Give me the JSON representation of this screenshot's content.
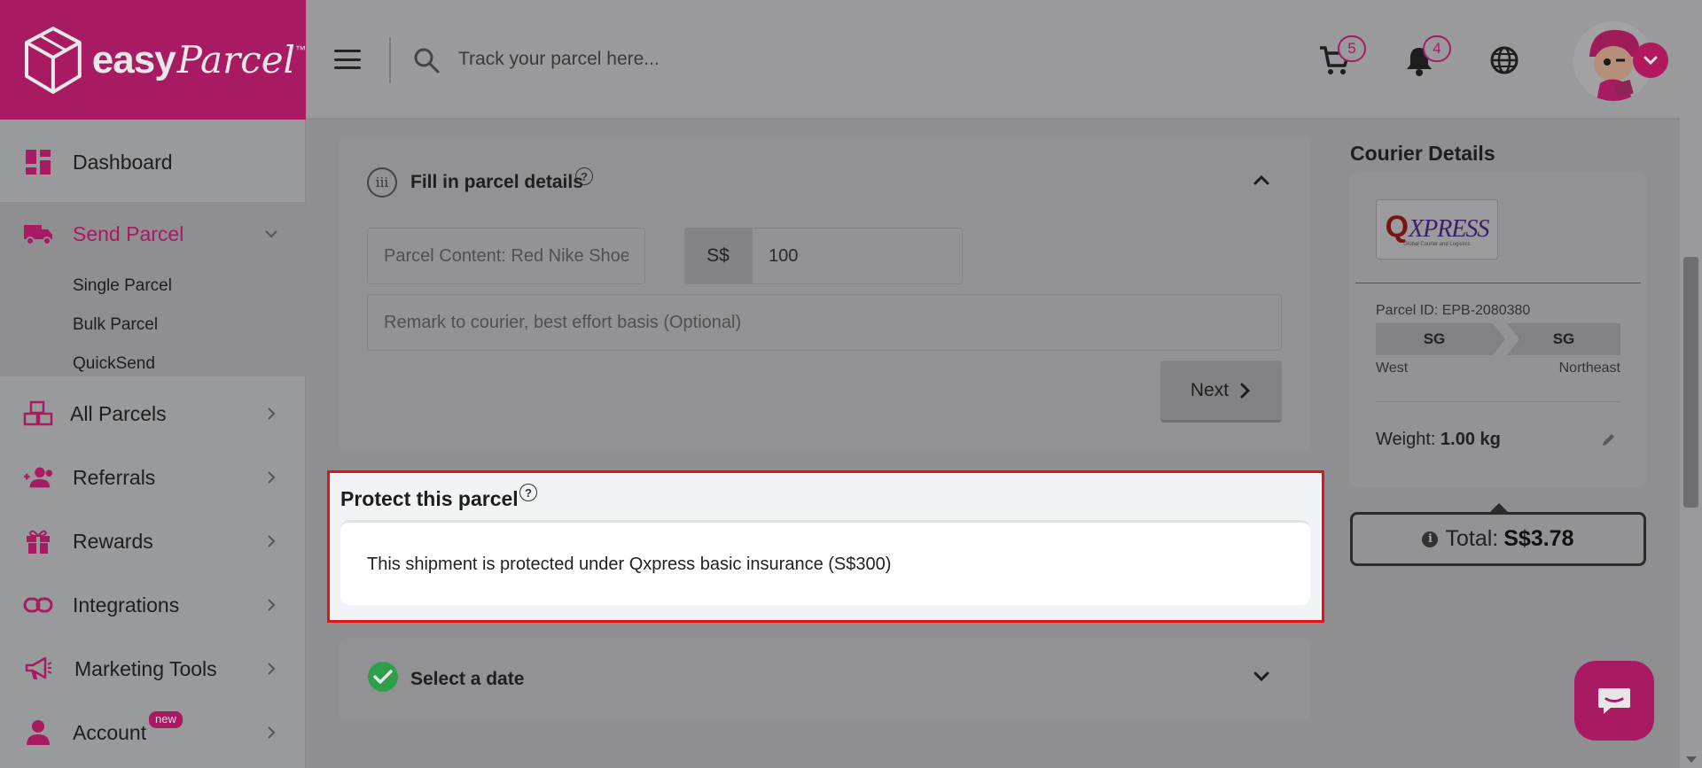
{
  "brand": {
    "word1": "easy",
    "word2": "Parcel",
    "tm": "™"
  },
  "header": {
    "search_placeholder": "Track your parcel here...",
    "cart_count": "5",
    "notification_count": "4"
  },
  "sidebar": {
    "items": [
      {
        "label": "Dashboard"
      },
      {
        "label": "Send Parcel"
      },
      {
        "label": "All Parcels"
      },
      {
        "label": "Referrals"
      },
      {
        "label": "Rewards"
      },
      {
        "label": "Integrations"
      },
      {
        "label": "Marketing Tools"
      },
      {
        "label": "Account"
      }
    ],
    "sub_items": [
      {
        "label": "Single Parcel"
      },
      {
        "label": "Bulk Parcel"
      },
      {
        "label": "QuickSend"
      }
    ],
    "account_badge": "new"
  },
  "parcel_details": {
    "step": "iii",
    "title": "Fill in parcel details",
    "content_placeholder": "Parcel Content: Red Nike Shoe",
    "currency": "S$",
    "value": "100",
    "remark_placeholder": "Remark to courier, best effort basis (Optional)",
    "next_label": "Next"
  },
  "protect": {
    "title": "Protect this parcel",
    "text": "This shipment is protected under Qxpress basic insurance (S$300)"
  },
  "select_date": {
    "title": "Select a date"
  },
  "courier": {
    "heading": "Courier Details",
    "logo_q": "Q",
    "logo_rest": "XPRESS",
    "logo_sub": "Global Courier and Logistics",
    "parcel_id": "Parcel ID: EPB-2080380",
    "from_code": "SG",
    "to_code": "SG",
    "from_area": "West",
    "to_area": "Northeast",
    "weight_label": "Weight:",
    "weight_value": "1.00 kg",
    "total_label": "Total:",
    "total_value": "S$3.78"
  },
  "colors": {
    "brand": "#a81a62",
    "highlight_border": "#e01616",
    "success": "#2e9e4a"
  }
}
